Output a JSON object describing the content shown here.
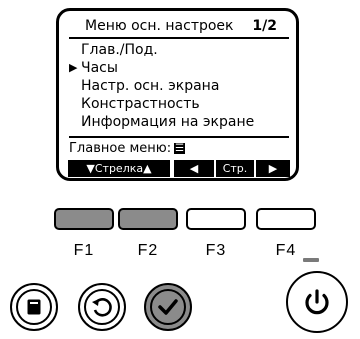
{
  "screen": {
    "title": "Меню осн. настроек",
    "page": "1/2",
    "cursor_glyph": "▶",
    "menu_items": [
      {
        "label": "Глав./Под.",
        "selected": false
      },
      {
        "label": "Часы",
        "selected": true
      },
      {
        "label": "Настр. осн. экрана",
        "selected": false
      },
      {
        "label": "Констрастность",
        "selected": false
      },
      {
        "label": "Информация на экране",
        "selected": false
      }
    ],
    "main_menu_label": "Главное меню:",
    "main_menu_symbol": "☰",
    "function_bar": {
      "f1_f2": "▼Стрелка▲",
      "f3": "◀",
      "f3_f4_label": "Стр.",
      "f4": "▶"
    }
  },
  "hardware": {
    "function_keys": [
      {
        "label": "F1",
        "style": "pressed"
      },
      {
        "label": "F2",
        "style": "pressed"
      },
      {
        "label": "F3",
        "style": "normal"
      },
      {
        "label": "F4",
        "style": "normal"
      }
    ],
    "buttons": [
      "menu-icon",
      "return-icon",
      "confirm-icon",
      "power-icon"
    ],
    "colors": {
      "pressed_key": "#8b8b8b",
      "confirm_button": "#8b8b8b",
      "outline": "#000000"
    }
  }
}
